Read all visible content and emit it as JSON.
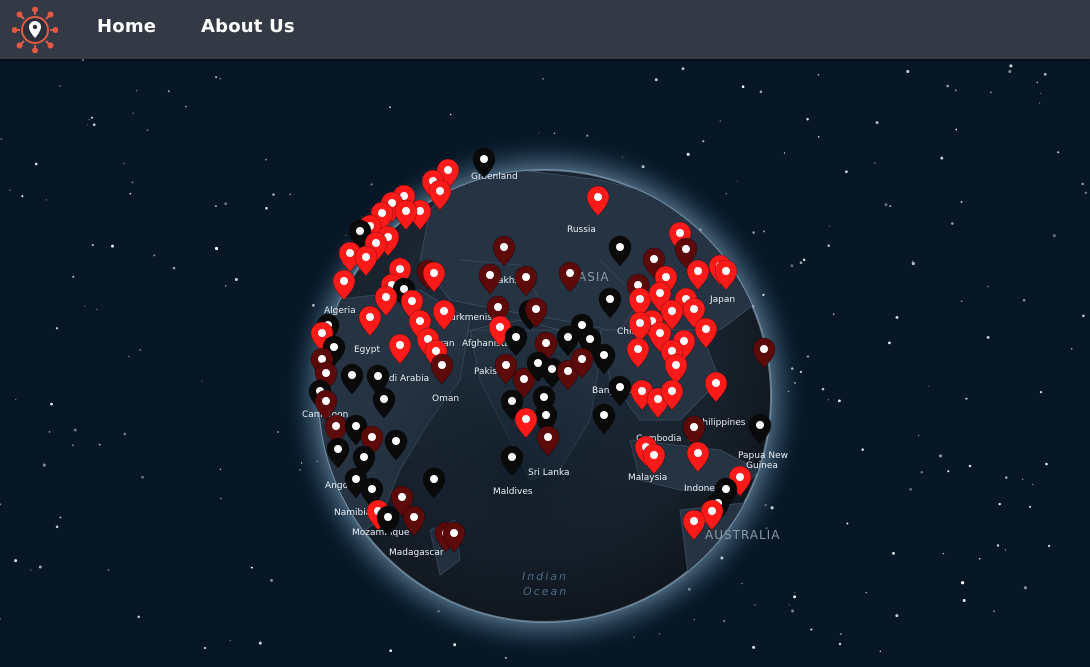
{
  "nav": {
    "logo_icon": "globe-pin-logo-icon",
    "links": [
      {
        "label": "Home"
      },
      {
        "label": "About Us"
      }
    ]
  },
  "colors": {
    "navbar": "#343a45",
    "space": "#071726",
    "globe": "#1a2633",
    "marker_red": "#ff1a1a",
    "marker_dark_red": "#5c0a0a",
    "marker_black": "#0a0a0a"
  },
  "globe": {
    "labels": {
      "greenland": "Greenland",
      "russia": "Russia",
      "asia": "ASIA",
      "kazakhstan": "Kazakhstan",
      "turkmenistan": "Turkmenistan",
      "japan": "Japan",
      "algeria": "Algeria",
      "egypt": "Egypt",
      "iran": "Iran",
      "afghanistan": "Afghanistan",
      "pakistan": "Pakistan",
      "china": "China",
      "saudi_arabia": "Saudi Arabia",
      "oman": "Oman",
      "bangladesh": "Bangladesh",
      "cameroon": "Cameroon",
      "philippines": "Philippines",
      "cambodia": "Cambodia",
      "papua_new_guinea_1": "Papua New",
      "papua_new_guinea_2": "Guinea",
      "sri_lanka": "Sri Lanka",
      "malaysia": "Malaysia",
      "indonesia": "Indonesia",
      "angola": "Angola",
      "namibia": "Namibia",
      "maldives": "Maldives",
      "madagascar": "Madagascar",
      "mozambique": "Mozambique",
      "australia": "AUSTRALIA",
      "indian_ocean_1": "Indian",
      "indian_ocean_2": "Ocean"
    }
  }
}
